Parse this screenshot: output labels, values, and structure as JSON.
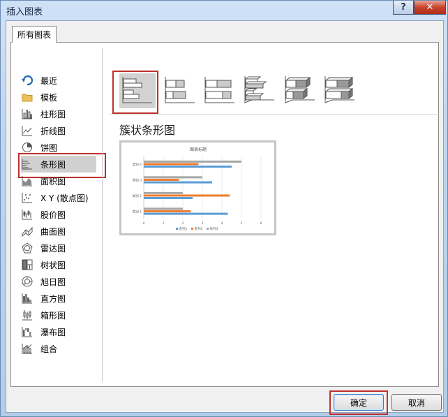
{
  "window": {
    "title": "插入图表",
    "help_label": "?",
    "close_label": "✕"
  },
  "tab": {
    "label": "所有图表"
  },
  "sidebar": {
    "items": [
      {
        "label": "最近",
        "icon": "recent-icon"
      },
      {
        "label": "模板",
        "icon": "folder-icon"
      },
      {
        "label": "柱形图",
        "icon": "column-chart-icon"
      },
      {
        "label": "折线图",
        "icon": "line-chart-icon"
      },
      {
        "label": "饼图",
        "icon": "pie-chart-icon"
      },
      {
        "label": "条形图",
        "icon": "bar-chart-icon",
        "selected": true
      },
      {
        "label": "面积图",
        "icon": "area-chart-icon"
      },
      {
        "label": "X Y (散点图)",
        "icon": "scatter-chart-icon"
      },
      {
        "label": "股价图",
        "icon": "stock-chart-icon"
      },
      {
        "label": "曲面图",
        "icon": "surface-chart-icon"
      },
      {
        "label": "雷达图",
        "icon": "radar-chart-icon"
      },
      {
        "label": "树状图",
        "icon": "treemap-chart-icon"
      },
      {
        "label": "旭日图",
        "icon": "sunburst-chart-icon"
      },
      {
        "label": "直方图",
        "icon": "histogram-chart-icon"
      },
      {
        "label": "箱形图",
        "icon": "box-whisker-chart-icon"
      },
      {
        "label": "瀑布图",
        "icon": "waterfall-chart-icon"
      },
      {
        "label": "组合",
        "icon": "combo-chart-icon"
      }
    ]
  },
  "subtypes": {
    "selected_title": "簇状条形图",
    "thumbs": [
      "clustered-bar-icon",
      "stacked-bar-icon",
      "100-stacked-bar-icon",
      "3d-clustered-bar-icon",
      "3d-stacked-bar-icon",
      "3d-100-stacked-bar-icon"
    ]
  },
  "buttons": {
    "ok": "确定",
    "cancel": "取消"
  },
  "colors": {
    "series1": "#5a9bd5",
    "series2": "#ed7d31",
    "series3": "#a5a5a5",
    "highlight": "#c0302b"
  },
  "chart_data": {
    "type": "bar",
    "title": "图表标题",
    "categories": [
      "类别 1",
      "类别 2",
      "类别 3",
      "类别 4"
    ],
    "series": [
      {
        "name": "系列1",
        "values": [
          4.3,
          2.5,
          3.5,
          4.5
        ]
      },
      {
        "name": "系列2",
        "values": [
          2.4,
          4.4,
          1.8,
          2.8
        ]
      },
      {
        "name": "系列3",
        "values": [
          2,
          2,
          3,
          5
        ]
      }
    ],
    "xlim": [
      0,
      6
    ],
    "x_ticks": [
      "0",
      "1",
      "2",
      "3",
      "4",
      "5",
      "6"
    ],
    "legend": "bottom",
    "grid": true
  }
}
